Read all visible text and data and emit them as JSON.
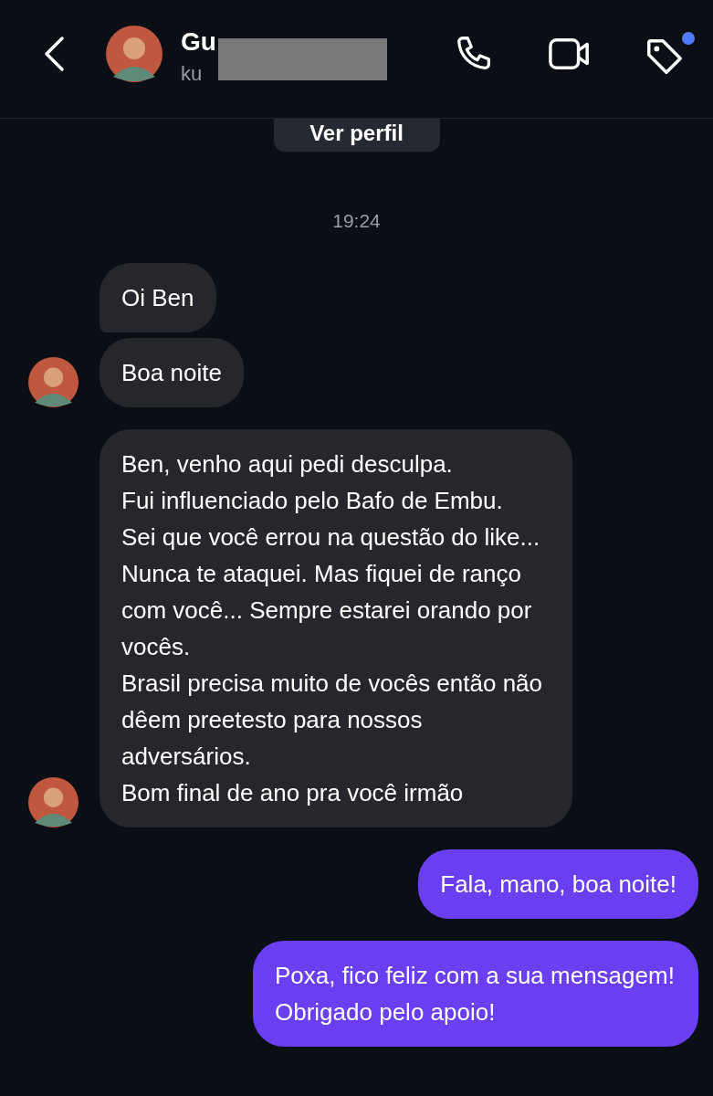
{
  "header": {
    "name": "Gu",
    "username": "ku",
    "redacted": true,
    "tag_notification": true
  },
  "profile_button": "Ver perfil",
  "timestamp": "19:24",
  "messages": [
    {
      "outgoing": false,
      "avatar": false,
      "text": "Oi Ben"
    },
    {
      "outgoing": false,
      "avatar": true,
      "text": "Boa noite"
    },
    {
      "outgoing": false,
      "avatar": true,
      "text": "Ben, venho aqui pedi desculpa.\nFui influenciado pelo Bafo de Embu.\nSei que você errou na questão do like...\nNunca te ataquei. Mas fiquei de ranço com você... Sempre estarei orando por vocês.\nBrasil precisa muito de vocês então não dêem preetesto para nossos adversários.\nBom final de ano pra você irmão"
    },
    {
      "outgoing": true,
      "text": "Fala, mano, boa noite!"
    },
    {
      "outgoing": true,
      "text": "Poxa, fico feliz com a sua mensagem! Obrigado pelo apoio!"
    }
  ]
}
